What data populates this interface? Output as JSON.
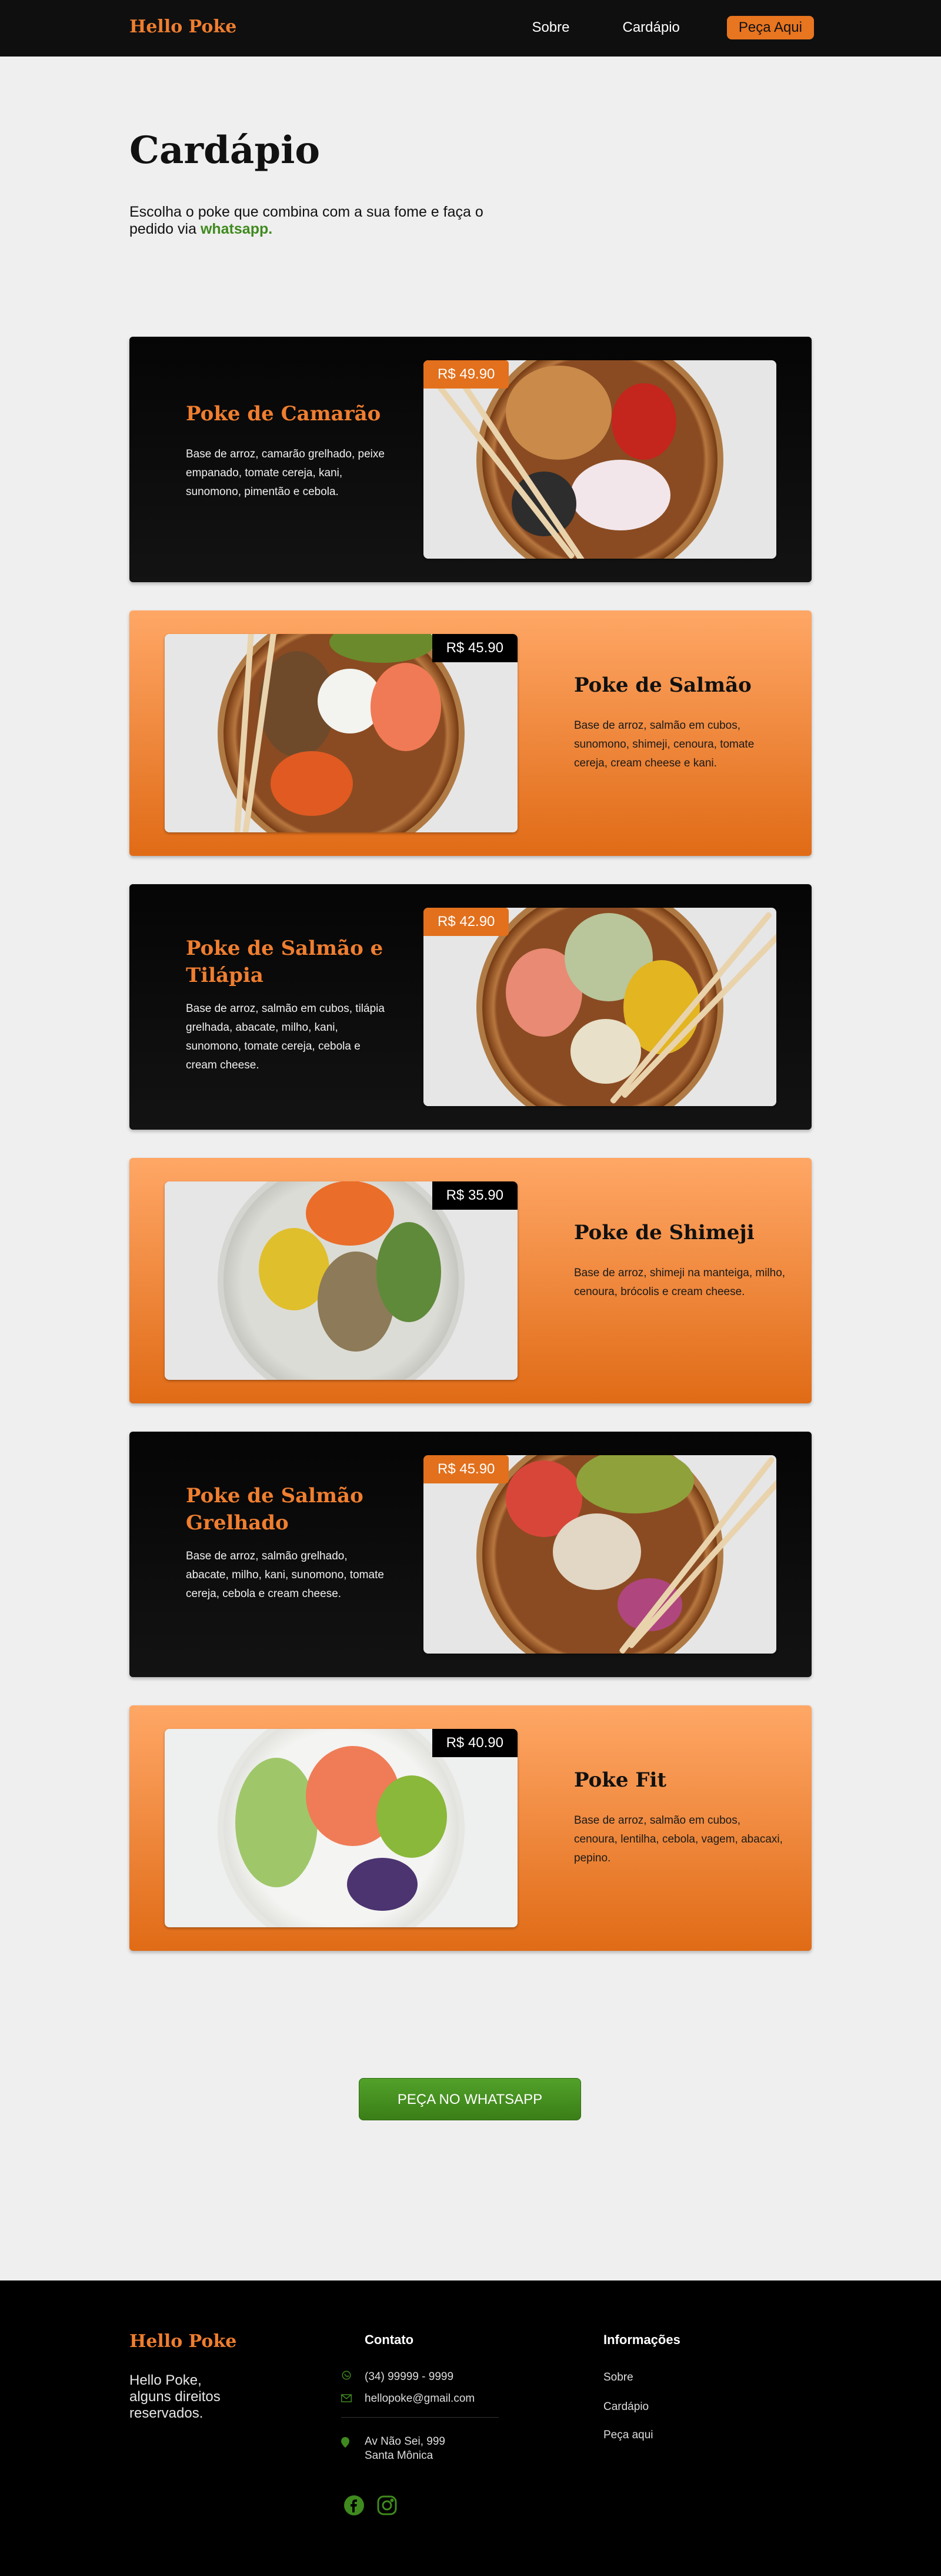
{
  "header": {
    "brand": "Hello Poke",
    "nav": [
      {
        "label": "Sobre"
      },
      {
        "label": "Cardápio"
      },
      {
        "label": "Peça Aqui"
      }
    ]
  },
  "hero": {
    "title": "Cardápio",
    "intro_text": "Escolha o poke que combina com a sua fome e faça o pedido via ",
    "intro_highlight": "whatsapp",
    "intro_end": "."
  },
  "menu": [
    {
      "name": "Poke de Camarão",
      "price": "R$ 49.90",
      "description": "Base de arroz, camarão grelhado, peixe empanado, tomate cereja, kani, sunomono, pimentão e cebola.",
      "theme": "dark"
    },
    {
      "name": "Poke de Salmão",
      "price": "R$ 45.90",
      "description": "Base de arroz,  salmão em cubos, sunomono, shimeji, cenoura, tomate cereja, cream cheese e kani.",
      "theme": "orange"
    },
    {
      "name": "Poke de Salmão e Tilápia",
      "price": "R$ 42.90",
      "description": "Base de arroz,  salmão em cubos, tilápia grelhada, abacate, milho, kani, sunomono, tomate cereja, cebola e cream cheese.",
      "theme": "dark"
    },
    {
      "name": "Poke de Shimeji",
      "price": "R$ 35.90",
      "description": "Base de arroz,  shimeji na manteiga, milho, cenoura, brócolis e cream cheese.",
      "theme": "orange"
    },
    {
      "name": "Poke de Salmão Grelhado",
      "price": "R$ 45.90",
      "description": "Base de arroz,  salmão grelhado, abacate, milho, kani, sunomono, tomate cereja, cebola e cream cheese.",
      "theme": "dark"
    },
    {
      "name": "Poke Fit",
      "price": "R$ 40.90",
      "description": "Base de arroz, salmão em cubos, cenoura, lentilha, cebola, vagem, abacaxi, pepino.",
      "theme": "orange"
    }
  ],
  "cta": {
    "label": "PEÇA NO WHATSAPP"
  },
  "footer": {
    "brand": "Hello Poke",
    "rights": "Hello Poke, alguns direitos reservados.",
    "contact": {
      "title": "Contato",
      "phone": "(34) 99999 - 9999",
      "email": "hellopoke@gmail.com",
      "address_line1": "Av Não Sei, 999",
      "address_line2": "Santa Mônica"
    },
    "info": {
      "title": "Informações",
      "links": [
        {
          "label": "Sobre"
        },
        {
          "label": "Cardápio"
        },
        {
          "label": "Peça aqui"
        }
      ]
    }
  },
  "colors": {
    "accent": "#ef7e2f",
    "whatsapp_green": "#3f8a1e",
    "dark_bg": "#0f0f0f",
    "page_bg": "#efefef"
  },
  "icons": [
    "whatsapp-icon",
    "mail-icon",
    "location-pin-icon",
    "facebook-icon",
    "instagram-icon"
  ]
}
